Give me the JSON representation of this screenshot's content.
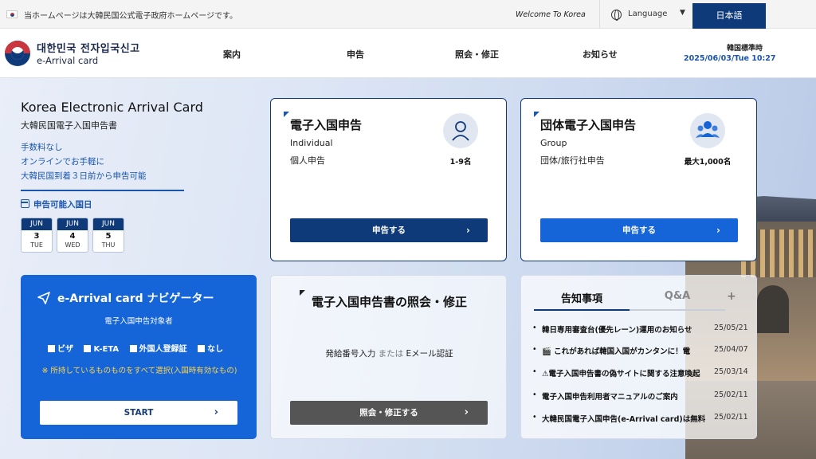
{
  "topbar": {
    "notice": "当ホームページは大韓民国公式電子政府ホームページです。",
    "welcome": "Welcome To Korea",
    "language_label": "Language",
    "language_caret": "▼",
    "current_language": "日本語"
  },
  "header": {
    "logo_kr": "대한민국 전자입국신고",
    "logo_en": "e-Arrival card",
    "nav": [
      "案内",
      "申告",
      "照会・修正",
      "お知らせ"
    ],
    "clock_label": "韓国標準時",
    "clock_time": "2025/06/03/Tue 10:27"
  },
  "intro": {
    "title": "Korea Electronic Arrival Card",
    "subtitle": "大韓民国電子入国申告書",
    "lines": [
      "手数料なし",
      "オンラインでお手軽に",
      "大韓民国到着３日前から申告可能"
    ],
    "available_label": "申告可能入国日",
    "dates": [
      {
        "month": "JUN",
        "day": "3",
        "weekday": "TUE"
      },
      {
        "month": "JUN",
        "day": "4",
        "weekday": "WED"
      },
      {
        "month": "JUN",
        "day": "5",
        "weekday": "THU"
      }
    ]
  },
  "individual_card": {
    "title": "電子入国申告",
    "en": "Individual",
    "jp": "個人申告",
    "count": "1-9名",
    "button": "申告する"
  },
  "group_card": {
    "title": "団体電子入国申告",
    "en": "Group",
    "jp": "団体/旅行社申告",
    "count": "最大1,000名",
    "button": "申告する"
  },
  "navigator": {
    "title": "e-Arrival card ナビゲーター",
    "subtitle": "電子入国申告対象者",
    "options": [
      "ビザ",
      "K-ETA",
      "外国人登録証",
      "なし"
    ],
    "warning": "※ 所持しているものものをすべて選択(入国時有効なもの)",
    "start": "START"
  },
  "inquiry": {
    "title": "電子入国申告書の照会・修正",
    "desc_a": "発給番号入力",
    "desc_or": "または",
    "desc_b": "Eメール認証",
    "button": "照会・修正する"
  },
  "board": {
    "tab_notice": "告知事項",
    "tab_qa": "Q&A",
    "plus": "+",
    "items": [
      {
        "title": "韓日専用審査台(優先レーン)運用のお知らせ",
        "date": "25/05/21"
      },
      {
        "title": "🎬 これがあれば韓国入国がカンタンに！電",
        "date": "25/04/07"
      },
      {
        "title": "⚠電子入国申告書の偽サイトに関する注意喚起",
        "date": "25/03/14"
      },
      {
        "title": "電子入国申告利用者マニュアルのご案内",
        "date": "25/02/11"
      },
      {
        "title": "大韓民国電子入国申告(e-Arrival card)は無料",
        "date": "25/02/11"
      }
    ]
  },
  "colors": {
    "primary_navy": "#0f3a7a",
    "navigator_blue": "#1565d8",
    "group_button_blue": "#1565d8",
    "accent_blue": "#1a56b0",
    "warning_yellow": "#ffd64a"
  }
}
